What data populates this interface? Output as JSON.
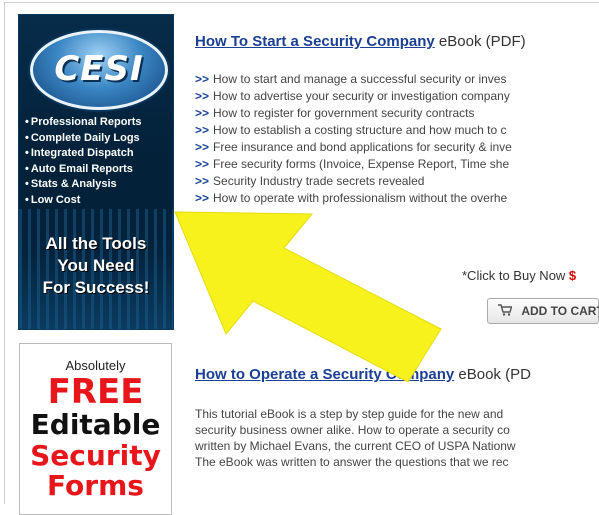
{
  "banner": {
    "logo_text": "CESI",
    "features": [
      "Professional Reports",
      "Complete Daily Logs",
      "Integrated Dispatch",
      "Auto Email Reports",
      "Stats & Analysis",
      "Low Cost"
    ],
    "tagline_lines": [
      "All the Tools",
      "You Need",
      "For Success!"
    ]
  },
  "free_forms": {
    "line1": "Absolutely",
    "line2": "FREE",
    "line3": "Editable",
    "line4": "Security",
    "line5": "Forms"
  },
  "product1": {
    "title_link": "How To Start a Security Company",
    "title_suffix": " eBook (PDF)",
    "bullet_marker": ">>",
    "bullets": [
      "How to start and manage a successful security or inves",
      "How to advertise your security or investigation company",
      "How to register for government security contracts",
      "How to establish a costing structure and how much to c",
      "Free insurance and bond applications for security & inve",
      "Free security forms (Invoice, Expense Report, Time she",
      "Security Industry trade secrets revealed",
      "How to operate with professionalism without the overhe"
    ],
    "cta_text": "*Click to Buy Now ",
    "cta_price": "$",
    "add_to_cart_label": "ADD TO CART"
  },
  "product2": {
    "title_link": "How to Operate a Security Company",
    "title_suffix": " eBook (PD",
    "description_lines": [
      "This tutorial eBook is a step by step guide for the new and",
      "security business owner alike. How to operate a security co",
      "written by Michael Evans, the current CEO of USPA Nationw",
      "The eBook was written to answer the questions that we rec"
    ]
  },
  "colors": {
    "arrow": "#f7f21b",
    "link": "#1a3f93",
    "price": "#d40000",
    "free_red": "#e8161b"
  }
}
